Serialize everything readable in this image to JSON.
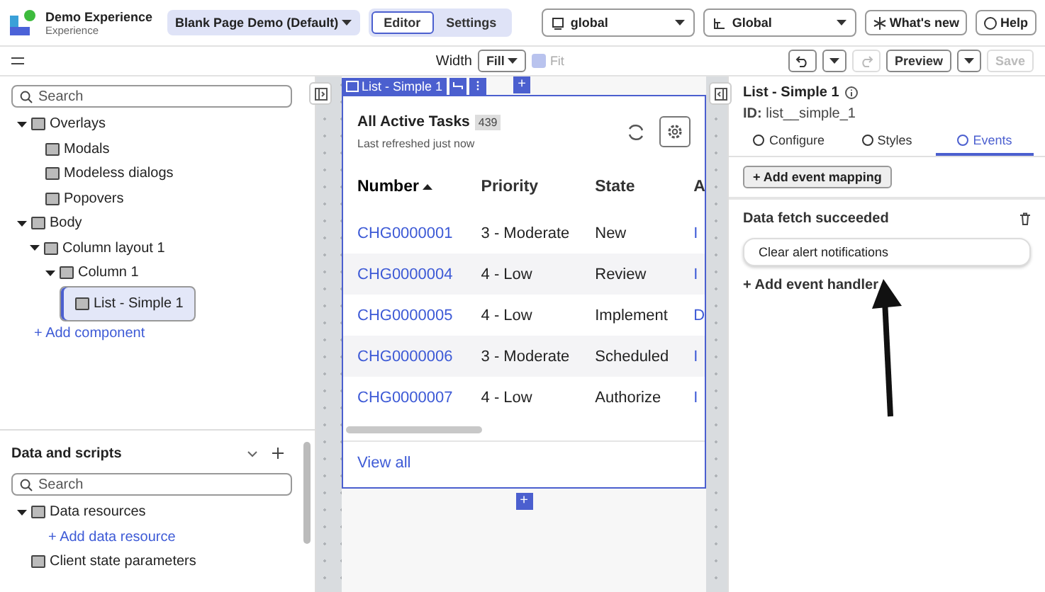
{
  "app": {
    "title": "Demo Experience",
    "subtitle": "Experience"
  },
  "page_select": {
    "value": "Blank Page Demo (Default)"
  },
  "mode_tabs": [
    {
      "label": "Editor",
      "selected": true
    },
    {
      "label": "Settings",
      "selected": false
    }
  ],
  "scope_select": {
    "value": "global"
  },
  "app_select": {
    "value": "Global"
  },
  "header_buttons": [
    "What's new",
    "Help"
  ],
  "toolbar": {
    "width_label": "Width",
    "width_value": "Fill",
    "fit": {
      "label": "Fit",
      "checked": true,
      "disabled": true
    },
    "preview": "Preview",
    "save": {
      "label": "Save",
      "disabled": true
    },
    "redo_disabled": true
  },
  "outline": {
    "search": {
      "placeholder": "Search"
    },
    "tree": [
      {
        "label": "Overlays",
        "expanded": true,
        "selected": false,
        "children": [
          {
            "label": "Modals",
            "selected": false
          },
          {
            "label": "Modeless dialogs",
            "selected": false
          },
          {
            "label": "Popovers",
            "selected": false
          }
        ]
      },
      {
        "label": "Body",
        "expanded": true,
        "selected": false,
        "children": [
          {
            "label": "Column layout 1",
            "expanded": true,
            "selected": false,
            "children": [
              {
                "label": "Column 1",
                "expanded": true,
                "selected": false,
                "children": [
                  {
                    "label": "List - Simple 1",
                    "selected": true
                  }
                ]
              }
            ]
          }
        ]
      }
    ],
    "add_link": "+ Add component"
  },
  "data_panel": {
    "title": "Data and scripts",
    "search": {
      "placeholder": "Search"
    },
    "tree": [
      {
        "label": "Data resources",
        "expanded": true,
        "children": [
          {
            "label": "+ Add data resource",
            "kind": "link"
          }
        ]
      },
      {
        "label": "Client state parameters"
      }
    ]
  },
  "canvas": {
    "component_tag": "List - Simple 1",
    "add_symbol": "+",
    "card": {
      "title": "All Active Tasks",
      "count": "439",
      "subtitle": "Last refreshed just now",
      "footer_link": "View all",
      "columns": [
        {
          "label": "Number",
          "sorted": true
        },
        {
          "label": "Priority",
          "sorted": false
        },
        {
          "label": "State",
          "sorted": false
        },
        {
          "label": "A",
          "sorted": false
        }
      ],
      "rows": [
        [
          "CHG0000001",
          "3 - Moderate",
          "New",
          "I"
        ],
        [
          "CHG0000004",
          "4 - Low",
          "Review",
          "I"
        ],
        [
          "CHG0000005",
          "4 - Low",
          "Implement",
          "D"
        ],
        [
          "CHG0000006",
          "3 - Moderate",
          "Scheduled",
          "I"
        ],
        [
          "CHG0000007",
          "4 - Low",
          "Authorize",
          "I"
        ]
      ]
    }
  },
  "inspector": {
    "title": "List - Simple 1",
    "id_text": "**ID:** list__simple_1",
    "tabs": [
      {
        "label": "Configure",
        "selected": false
      },
      {
        "label": "Styles",
        "selected": false
      },
      {
        "label": "Events",
        "selected": true
      }
    ],
    "add_mapping": "+ Add event mapping",
    "event": {
      "name": "Data fetch succeeded",
      "handlers": [
        "Clear alert notifications"
      ],
      "add_handler": "+ Add event handler"
    }
  }
}
